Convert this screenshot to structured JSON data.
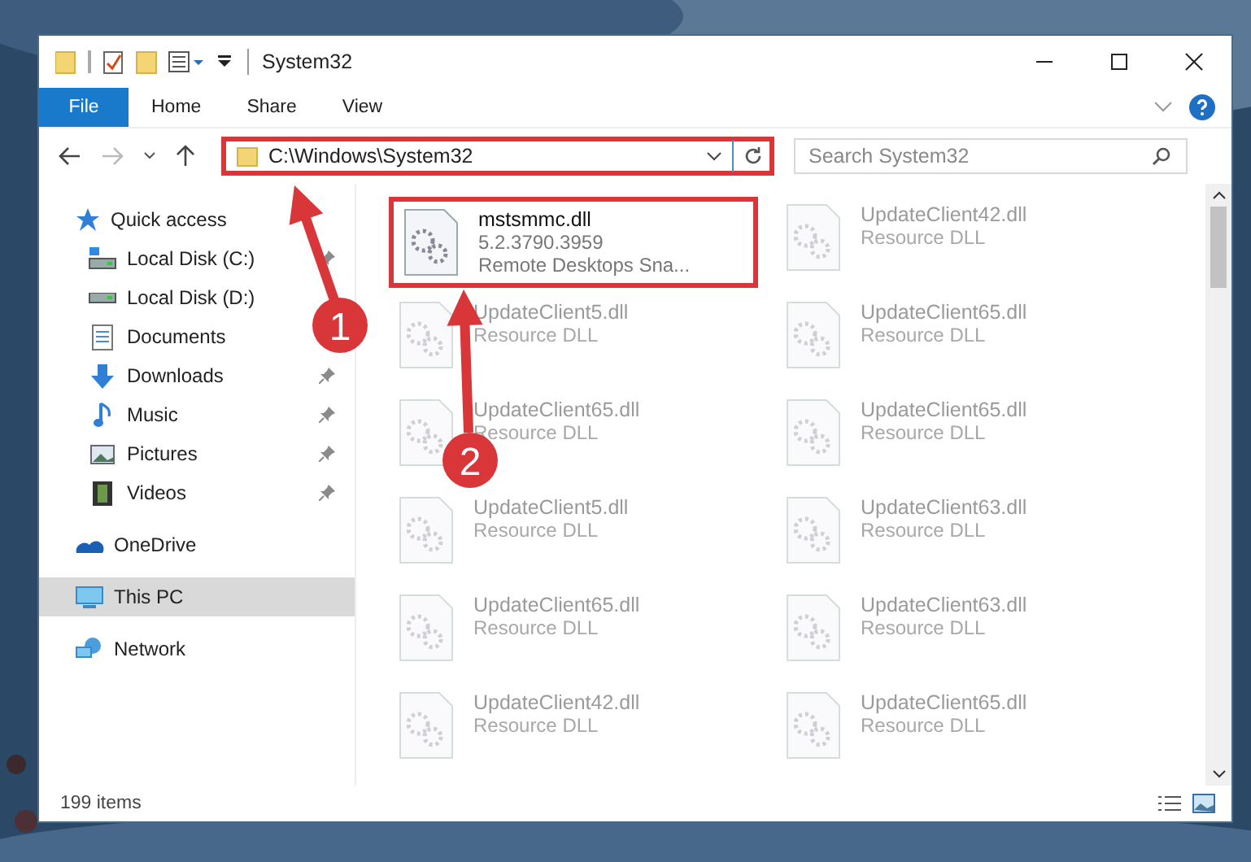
{
  "window": {
    "title": "System32"
  },
  "ribbon": {
    "tabs": [
      {
        "label": "File",
        "selected": true
      },
      {
        "label": "Home",
        "selected": false
      },
      {
        "label": "Share",
        "selected": false
      },
      {
        "label": "View",
        "selected": false
      }
    ]
  },
  "address": {
    "path": "C:\\Windows\\System32",
    "highlighted": true
  },
  "search": {
    "placeholder": "Search System32"
  },
  "sidebar": {
    "items": [
      {
        "label": "Quick access",
        "kind": "star",
        "selected": false,
        "children": [
          {
            "label": "Local Disk (C:)",
            "kind": "windisk",
            "pinned": true
          },
          {
            "label": "Local Disk (D:)",
            "kind": "disk",
            "pinned": false
          },
          {
            "label": "Documents",
            "kind": "document",
            "pinned": false
          },
          {
            "label": "Downloads",
            "kind": "download",
            "pinned": true
          },
          {
            "label": "Music",
            "kind": "music",
            "pinned": true
          },
          {
            "label": "Pictures",
            "kind": "pictures",
            "pinned": true
          },
          {
            "label": "Videos",
            "kind": "videos",
            "pinned": true
          }
        ]
      },
      {
        "label": "OneDrive",
        "kind": "cloud",
        "selected": false
      },
      {
        "label": "This PC",
        "kind": "computer",
        "selected": true
      },
      {
        "label": "Network",
        "kind": "network",
        "selected": false
      }
    ]
  },
  "files": [
    {
      "name": "mstsmmc.dll",
      "details": [
        "5.2.3790.3959",
        "Remote Desktops Sna..."
      ],
      "highlighted": true
    },
    {
      "name": "UpdateClient42.dll",
      "details": [
        "Resource DLL"
      ],
      "highlighted": false
    },
    {
      "name": "UpdateClient5.dll",
      "details": [
        "Resource DLL"
      ],
      "highlighted": false
    },
    {
      "name": "UpdateClient65.dll",
      "details": [
        "Resource DLL"
      ],
      "highlighted": false
    },
    {
      "name": "UpdateClient65.dll",
      "details": [
        "Resource DLL"
      ],
      "highlighted": false
    },
    {
      "name": "UpdateClient65.dll",
      "details": [
        "Resource DLL"
      ],
      "highlighted": false
    },
    {
      "name": "UpdateClient5.dll",
      "details": [
        "Resource DLL"
      ],
      "highlighted": false
    },
    {
      "name": "UpdateClient63.dll",
      "details": [
        "Resource DLL"
      ],
      "highlighted": false
    },
    {
      "name": "UpdateClient65.dll",
      "details": [
        "Resource DLL"
      ],
      "highlighted": false
    },
    {
      "name": "UpdateClient63.dll",
      "details": [
        "Resource DLL"
      ],
      "highlighted": false
    },
    {
      "name": "UpdateClient42.dll",
      "details": [
        "Resource DLL"
      ],
      "highlighted": false
    },
    {
      "name": "UpdateClient65.dll",
      "details": [
        "Resource DLL"
      ],
      "highlighted": false
    }
  ],
  "status_bar": {
    "count": "199 items"
  },
  "annotations": [
    {
      "number": "1"
    },
    {
      "number": "2"
    }
  ]
}
